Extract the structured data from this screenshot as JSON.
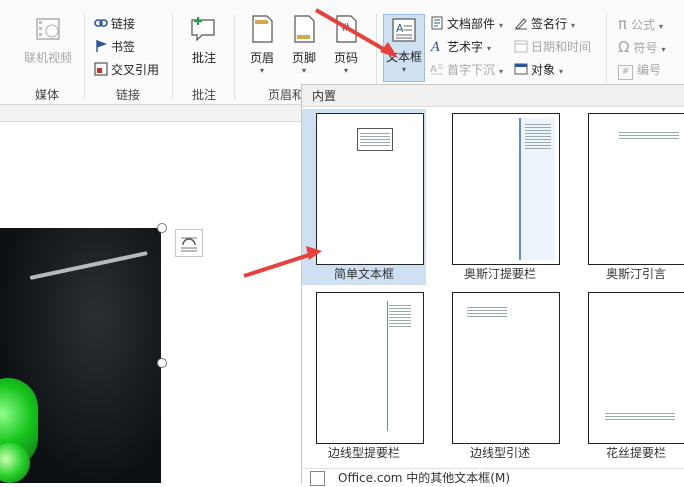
{
  "ribbon": {
    "groups": {
      "media": {
        "label": "媒体",
        "video": "联机视频"
      },
      "links": {
        "label": "链接",
        "link": "链接",
        "bookmark": "书签",
        "crossref": "交叉引用"
      },
      "comments": {
        "label": "批注",
        "comment": "批注"
      },
      "header_footer": {
        "label": "页眉和",
        "header": "页眉",
        "footer": "页脚",
        "page_number": "页码"
      },
      "text": {
        "textbox": "文本框",
        "quick_parts": "文档部件",
        "wordart": "艺术字",
        "dropcap": "首字下沉",
        "signature": "签名行",
        "datetime": "日期和时间",
        "object": "对象"
      },
      "symbols": {
        "equation": "公式",
        "symbol": "符号",
        "number": "编号"
      }
    }
  },
  "gallery": {
    "header": "内置",
    "items": [
      {
        "label": "简单文本框",
        "selected": true
      },
      {
        "label": "奥斯汀提要栏",
        "selected": false
      },
      {
        "label": "奥斯汀引言",
        "selected": false
      },
      {
        "label": "边线型提要栏",
        "selected": false
      },
      {
        "label": "边线型引述",
        "selected": false
      },
      {
        "label": "花丝提要栏",
        "selected": false
      }
    ],
    "footer": "Office.com 中的其他文本框(M)"
  },
  "colors": {
    "accent": "#2b579a",
    "selected": "#cfe0f2",
    "arrow": "#e8413b"
  }
}
